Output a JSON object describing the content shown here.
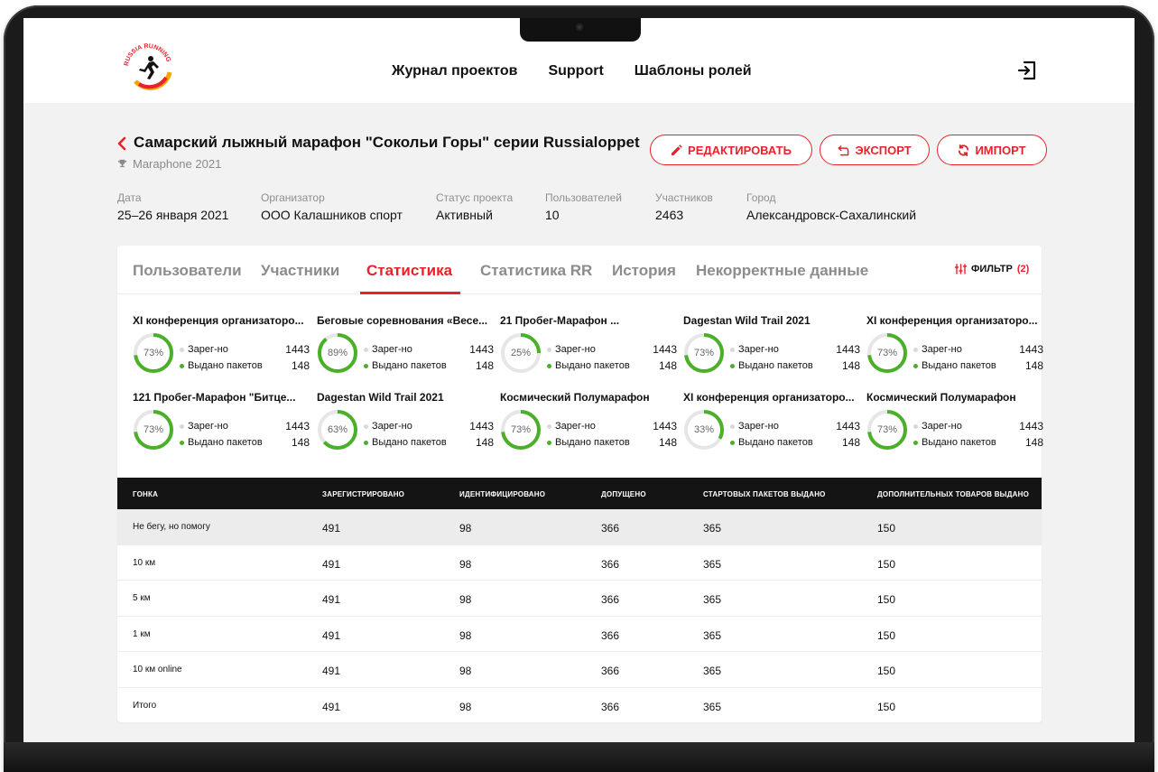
{
  "nav": {
    "items": [
      "Журнал проектов",
      "Support",
      "Шаблоны ролей"
    ]
  },
  "logo": {
    "text": "RUSSIA RUNNING"
  },
  "project": {
    "title": "Самарский лыжный марафон \"Сокольи Горы\" серии Russialoppet",
    "subtitle": "Maraphone 2021"
  },
  "actions": {
    "edit": "РЕДАКТИРОВАТЬ",
    "export": "ЭКСПОРТ",
    "import": "ИМПОРТ"
  },
  "meta": [
    {
      "label": "Дата",
      "value": "25–26 января 2021"
    },
    {
      "label": "Организатор",
      "value": "ООО Калашников спорт"
    },
    {
      "label": "Статус проекта",
      "value": "Активный"
    },
    {
      "label": "Пользователей",
      "value": "10"
    },
    {
      "label": "Участников",
      "value": "2463"
    },
    {
      "label": "Город",
      "value": "Александровск-Сахалинский"
    }
  ],
  "tabs": [
    "Пользователи",
    "Участники",
    "Статистика",
    "Статистика RR",
    "История",
    "Некорректные данные"
  ],
  "active_tab": "Статистика",
  "filter": {
    "label": "ФИЛЬТР",
    "count": "(2)"
  },
  "stat_labels": {
    "registered": "Зарег-но",
    "issued": "Выдано пакетов"
  },
  "stats": [
    {
      "name": "XI конференция организаторо...",
      "percent": 73,
      "label": "73%",
      "registered": "1443",
      "issued": "148"
    },
    {
      "name": "Беговые соревнования «Весе...",
      "percent": 89,
      "label": "89%",
      "registered": "1443",
      "issued": "148"
    },
    {
      "name": "21 Пробег-Марафон ...",
      "percent": 25,
      "label": "25%",
      "registered": "1443",
      "issued": "148"
    },
    {
      "name": "Dagestan Wild Trail 2021",
      "percent": 73,
      "label": "73%",
      "registered": "1443",
      "issued": "148"
    },
    {
      "name": "XI конференция организаторо...",
      "percent": 73,
      "label": "73%",
      "registered": "1443",
      "issued": "148"
    },
    {
      "name": "121 Пробег-Марафон \"Битце...",
      "percent": 73,
      "label": "73%",
      "registered": "1443",
      "issued": "148"
    },
    {
      "name": "Dagestan Wild Trail 2021",
      "percent": 63,
      "label": "63%",
      "registered": "1443",
      "issued": "148"
    },
    {
      "name": "Космический Полумарафон",
      "percent": 73,
      "label": "73%",
      "registered": "1443",
      "issued": "148"
    },
    {
      "name": "XI конференция организаторо...",
      "percent": 33,
      "label": "33%",
      "registered": "1443",
      "issued": "148"
    },
    {
      "name": "Космический Полумарафон",
      "percent": 73,
      "label": "73%",
      "registered": "1443",
      "issued": "148"
    }
  ],
  "table": {
    "headers": [
      "ГОНКА",
      "ЗАРЕГИСТРИРОВАНО",
      "ИДЕНТИФИЦИРОВАНО",
      "ДОПУЩЕНО",
      "СТАРТОВЫХ ПАКЕТОВ ВЫДАНО",
      "ДОПОЛНИТЕЛЬНЫХ ТОВАРОВ ВЫДАНО"
    ],
    "rows": [
      [
        "Не бегу, но помогу",
        "491",
        "98",
        "366",
        "365",
        "150"
      ],
      [
        "10 км",
        "491",
        "98",
        "366",
        "365",
        "150"
      ],
      [
        "5 км",
        "491",
        "98",
        "366",
        "365",
        "150"
      ],
      [
        "1 км",
        "491",
        "98",
        "366",
        "365",
        "150"
      ],
      [
        "10 км online",
        "491",
        "98",
        "366",
        "365",
        "150"
      ],
      [
        "Итого",
        "491",
        "98",
        "366",
        "365",
        "150"
      ]
    ],
    "highlighted_row": 0
  },
  "colors": {
    "accent": "#e8222a",
    "donut_fill": "#4caf2a",
    "donut_track": "#e6e6e6",
    "registered_dot": "#d9d9d9",
    "issued_dot": "#4caf2a"
  }
}
